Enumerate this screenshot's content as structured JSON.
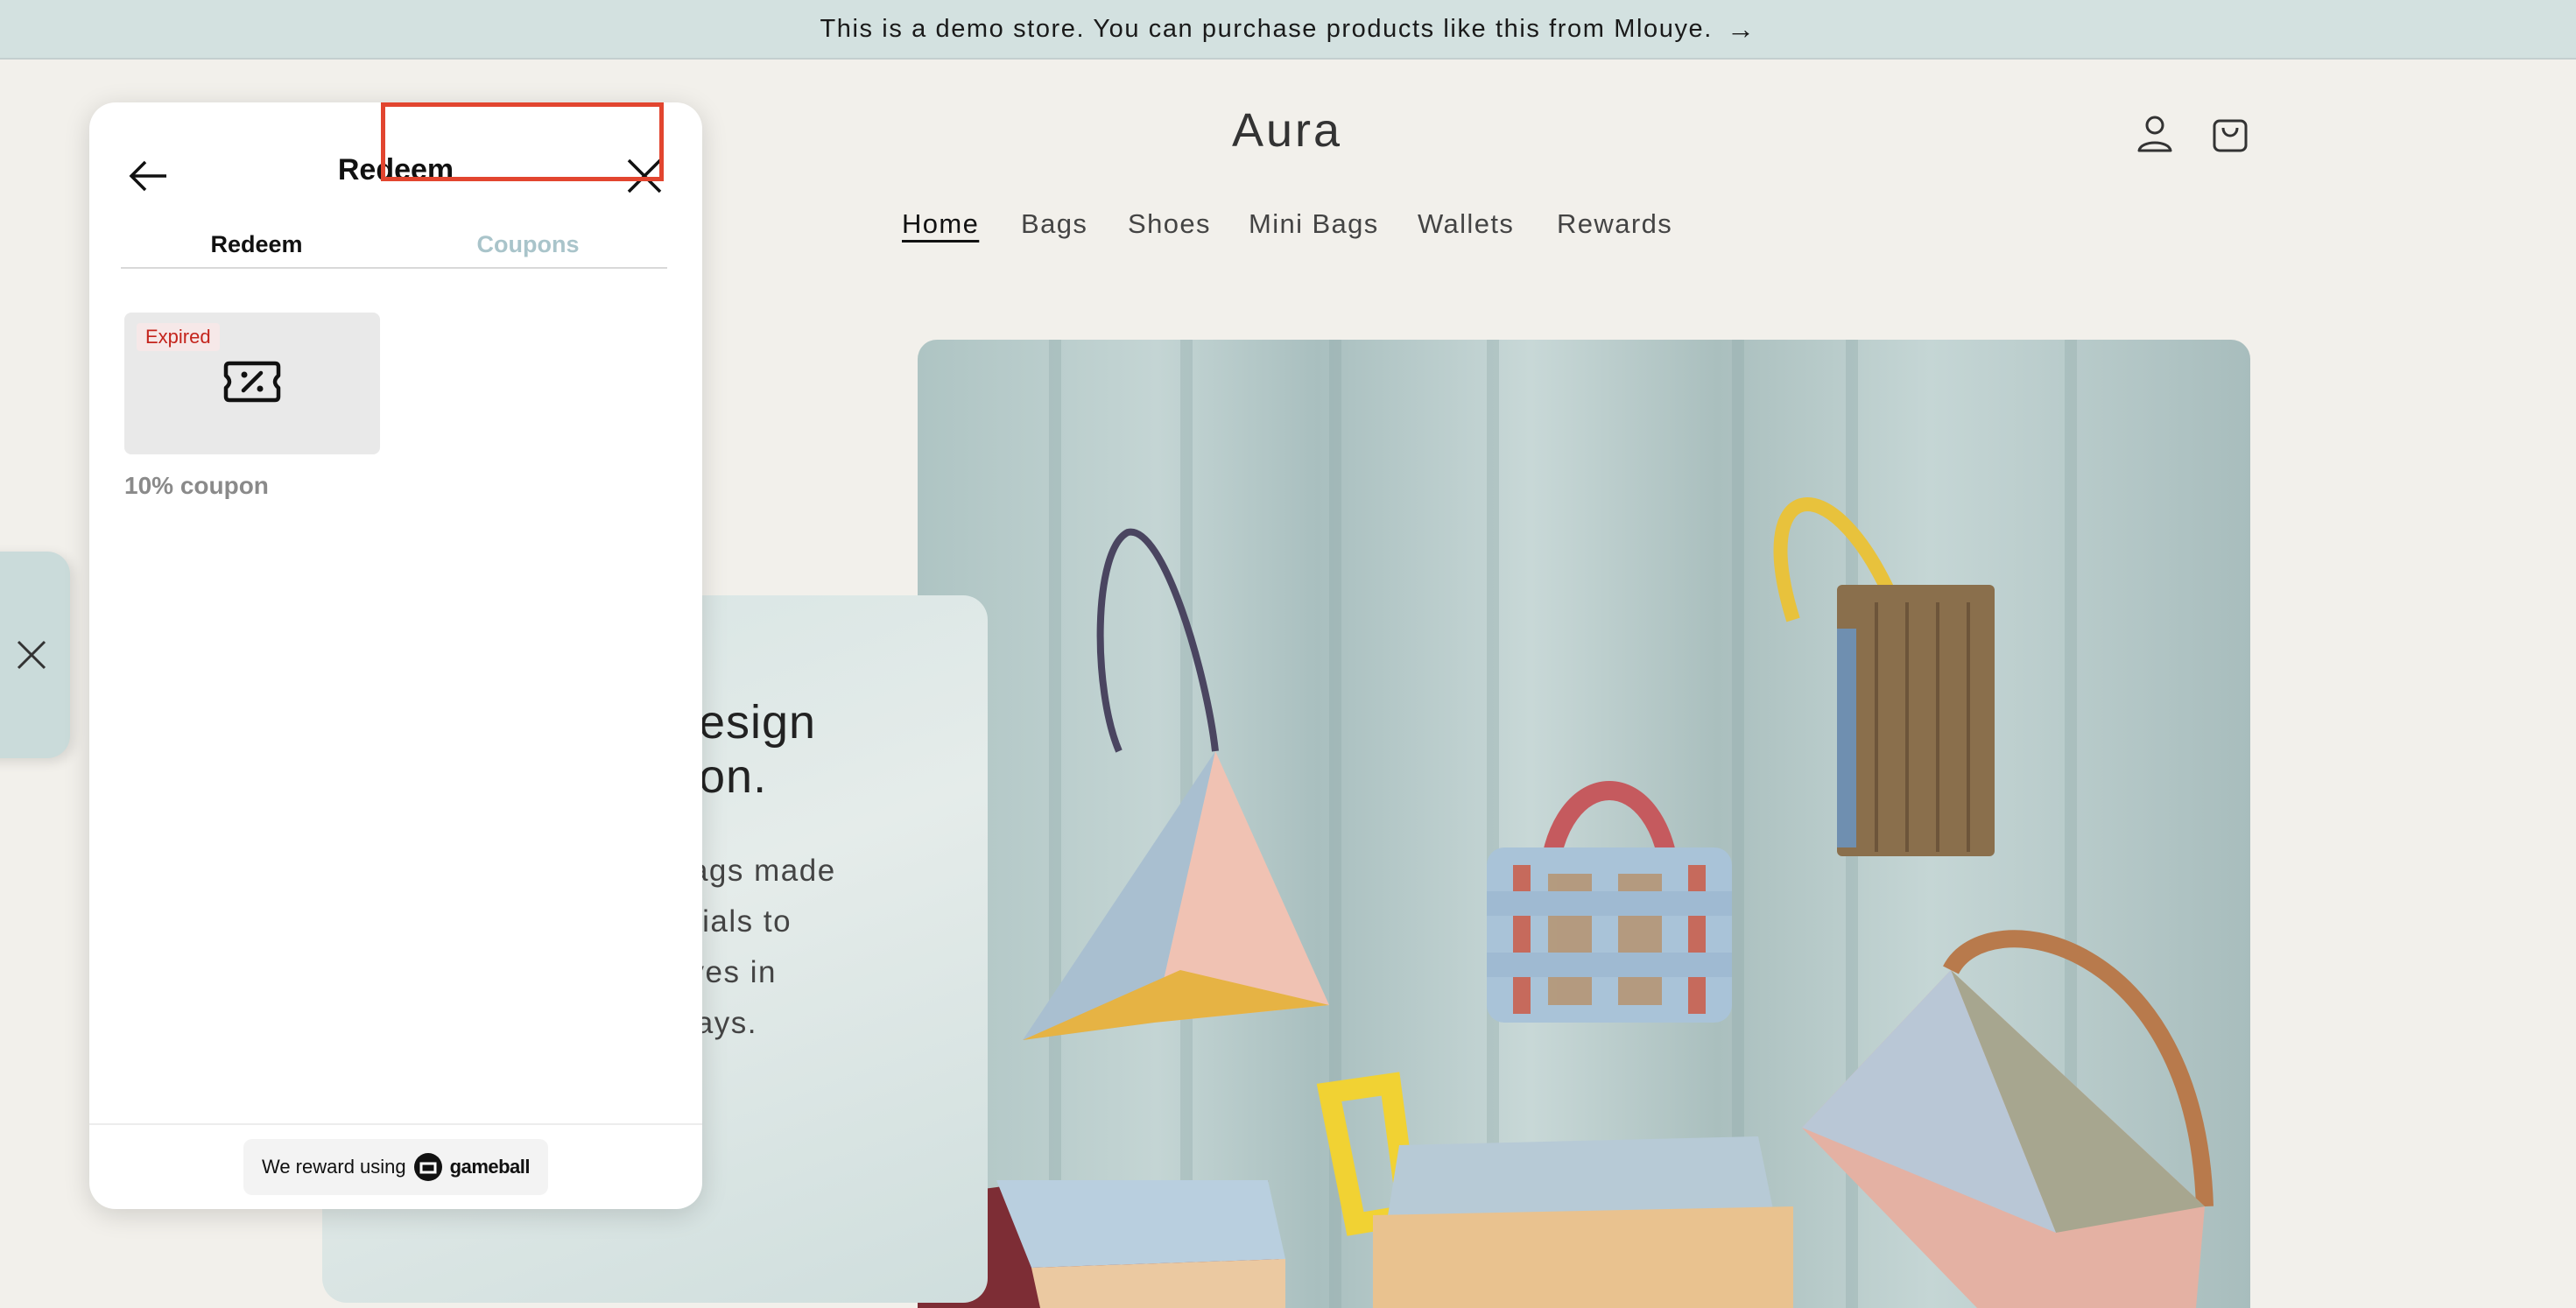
{
  "announcement": {
    "text": "This is a demo store. You can purchase products like this from Mlouye.",
    "arrow": "→"
  },
  "header": {
    "store_name": "Aura",
    "icons": [
      "account-icon",
      "cart-icon"
    ]
  },
  "nav": {
    "items": [
      {
        "label": "Home",
        "active": true
      },
      {
        "label": "Bags"
      },
      {
        "label": "Shoes"
      },
      {
        "label": "Mini Bags"
      },
      {
        "label": "Wallets"
      },
      {
        "label": "Rewards"
      }
    ]
  },
  "promo": {
    "heading": "esign\non.",
    "body": "bags made\nerials to\n lives in\n ways."
  },
  "widget": {
    "title": "Redeem",
    "tabs": [
      {
        "label": "Redeem",
        "active": false
      },
      {
        "label": "Coupons",
        "active": true
      }
    ],
    "coupons": [
      {
        "status": "Expired",
        "name": "10% coupon",
        "icon": "percent-ticket-icon"
      }
    ],
    "footer": {
      "prefix": "We reward using",
      "brand": "gameball"
    }
  },
  "colors": {
    "announcement_bg": "#d3e1e0",
    "page_bg": "#f2f0eb",
    "highlight": "#e2452f",
    "expired": "#c4241c",
    "tab_active": "#a9c4ca"
  }
}
